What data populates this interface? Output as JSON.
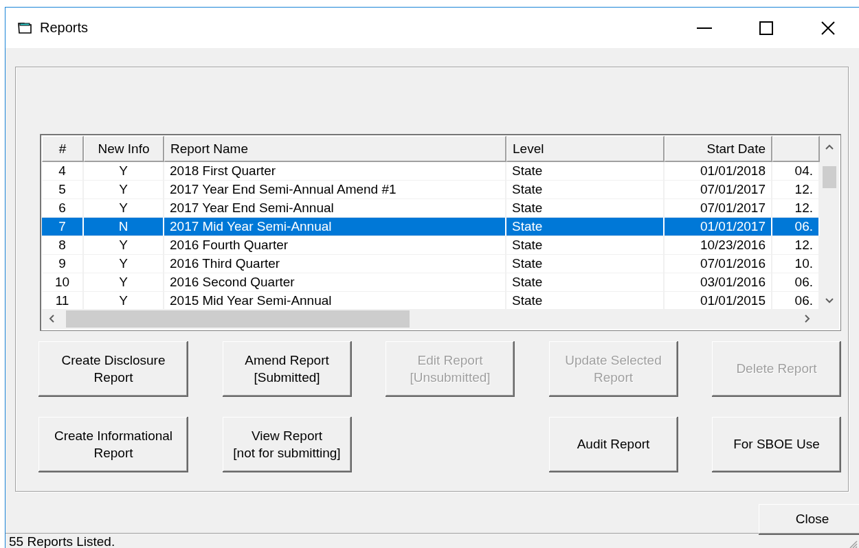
{
  "window": {
    "title": "Reports"
  },
  "table": {
    "columns": [
      {
        "label": "#"
      },
      {
        "label": "New Info"
      },
      {
        "label": "Report Name"
      },
      {
        "label": "Level"
      },
      {
        "label": "Start Date"
      },
      {}
    ],
    "rows": [
      {
        "cells": [
          "4",
          "Y",
          "2018 First Quarter",
          "State",
          "01/01/2018",
          "04."
        ],
        "selected": false
      },
      {
        "cells": [
          "5",
          "Y",
          "2017 Year End Semi-Annual Amend #1",
          "State",
          "07/01/2017",
          "12."
        ],
        "selected": false
      },
      {
        "cells": [
          "6",
          "Y",
          "2017 Year End Semi-Annual",
          "State",
          "07/01/2017",
          "12."
        ],
        "selected": false
      },
      {
        "cells": [
          "7",
          "N",
          "2017 Mid Year Semi-Annual",
          "State",
          "01/01/2017",
          "06."
        ],
        "selected": true
      },
      {
        "cells": [
          "8",
          "Y",
          "2016 Fourth Quarter",
          "State",
          "10/23/2016",
          "12."
        ],
        "selected": false
      },
      {
        "cells": [
          "9",
          "Y",
          "2016 Third Quarter",
          "State",
          "07/01/2016",
          "10."
        ],
        "selected": false
      },
      {
        "cells": [
          "10",
          "Y",
          "2016 Second Quarter",
          "State",
          "03/01/2016",
          "06."
        ],
        "selected": false
      },
      {
        "cells": [
          "11",
          "Y",
          "2015 Mid Year Semi-Annual",
          "State",
          "01/01/2015",
          "06."
        ],
        "selected": false
      }
    ]
  },
  "button_columns": [
    [
      {
        "label": "Create Disclosure\nReport",
        "disabled": false
      },
      {
        "label": "Create Informational\nReport",
        "disabled": false
      }
    ],
    [
      {
        "label": "Amend Report\n[Submitted]",
        "disabled": false
      },
      {
        "label": "View Report\n[not for submitting]",
        "disabled": false
      }
    ],
    [
      {
        "label": "Edit Report\n[Unsubmitted]",
        "disabled": true
      }
    ],
    [
      {
        "label": "Update Selected\nReport",
        "disabled": true
      },
      {
        "label": "Audit Report",
        "disabled": false
      }
    ],
    [
      {
        "label": "Delete Report",
        "disabled": true
      },
      {
        "label": "For SBOE Use",
        "disabled": false
      }
    ]
  ],
  "close_button": {
    "label": "Close",
    "disabled": false
  },
  "status_bar": {
    "text": "55 Reports Listed."
  }
}
